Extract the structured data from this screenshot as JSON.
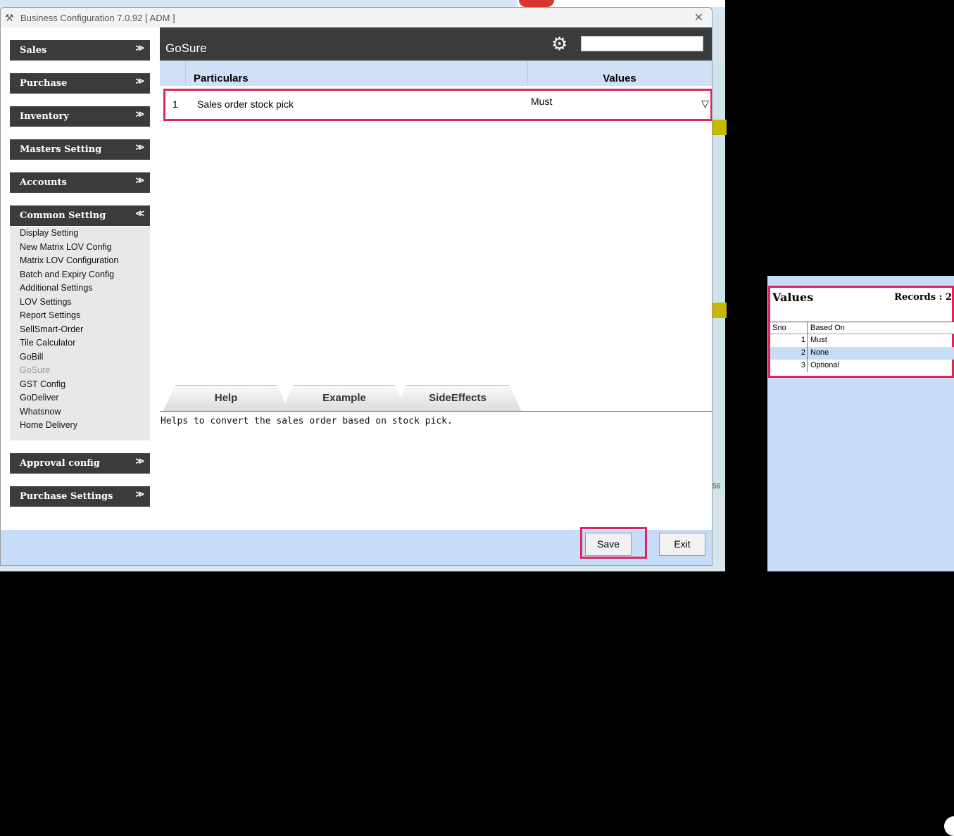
{
  "window": {
    "title": "Business Configuration 7.0.92 [ ADM ]",
    "close": "✕"
  },
  "sidebar": {
    "sections": [
      {
        "label": "Sales",
        "chevron": "≫"
      },
      {
        "label": "Purchase",
        "chevron": "≫"
      },
      {
        "label": "Inventory",
        "chevron": "≫"
      },
      {
        "label": "Masters Setting",
        "chevron": "≫"
      },
      {
        "label": "Accounts",
        "chevron": "≫"
      },
      {
        "label": "Common Setting",
        "chevron": "≪"
      },
      {
        "label": "Approval config",
        "chevron": "≫"
      },
      {
        "label": "Purchase Settings",
        "chevron": "≫"
      }
    ],
    "common_items": [
      "Display Setting",
      "New Matrix LOV Config",
      "Matrix LOV Configuration",
      "Batch and Expiry Config",
      "Additional Settings",
      "LOV Settings",
      "Report Settings",
      "SellSmart-Order",
      "Tile Calculator",
      "GoBill",
      "GoSure",
      "GST Config",
      "GoDeliver",
      "Whatsnow",
      "Home Delivery"
    ],
    "active_item": "GoSure"
  },
  "header": {
    "title": "GoSure",
    "gear_icon": "gear-icon"
  },
  "grid": {
    "col_particulars": "Particulars",
    "col_values": "Values",
    "rows": [
      {
        "sno": "1",
        "particular": "Sales order stock pick",
        "value": "Must",
        "dropdown": "▽"
      }
    ]
  },
  "tabs": {
    "help": "Help",
    "example": "Example",
    "side_effects": "SideEffects"
  },
  "help_text": "Helps to convert the sales order based on stock pick.",
  "buttons": {
    "save": "Save",
    "exit": "Exit"
  },
  "background": {
    "fragment": "56"
  },
  "popup": {
    "title": "Values",
    "records": "Records : 2",
    "col_sno": "Sno",
    "col_based_on": "Based On",
    "rows": [
      {
        "sno": "1",
        "value": "Must"
      },
      {
        "sno": "2",
        "value": "None"
      },
      {
        "sno": "3",
        "value": "Optional"
      }
    ]
  }
}
